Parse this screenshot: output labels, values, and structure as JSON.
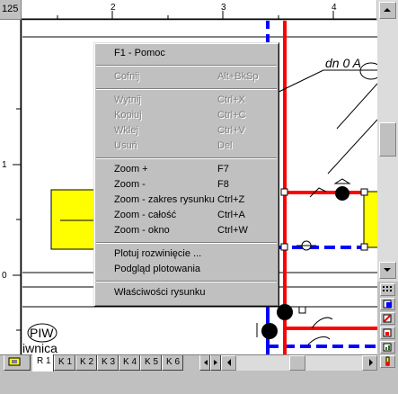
{
  "ruler": {
    "corner_label": "125",
    "top_ticks": [
      "2",
      "3",
      "4"
    ],
    "left_ticks": [
      "1",
      "0"
    ]
  },
  "drawing": {
    "label_dn": "dn 0 A",
    "label_piw": "PIW",
    "label_piwnica": "iwnica",
    "colors": {
      "supply": "#ff0000",
      "return": "#0000ff",
      "device": "#ffff00",
      "fitting": "#000000"
    }
  },
  "context_menu": {
    "groups": [
      [
        {
          "label": "F1 - Pomoc",
          "shortcut": "",
          "enabled": true
        }
      ],
      [
        {
          "label": "Cofnij",
          "shortcut": "Alt+BkSp",
          "enabled": false
        }
      ],
      [
        {
          "label": "Wytnij",
          "shortcut": "Ctrl+X",
          "enabled": false
        },
        {
          "label": "Kopiuj",
          "shortcut": "Ctrl+C",
          "enabled": false
        },
        {
          "label": "Wklej",
          "shortcut": "Ctrl+V",
          "enabled": false
        },
        {
          "label": "Usuń",
          "shortcut": "Del",
          "enabled": false
        }
      ],
      [
        {
          "label": "Zoom +",
          "shortcut": "F7",
          "enabled": true
        },
        {
          "label": "Zoom -",
          "shortcut": "F8",
          "enabled": true
        },
        {
          "label": "Zoom - zakres rysunku",
          "shortcut": "Ctrl+Z",
          "enabled": true
        },
        {
          "label": "Zoom - całość",
          "shortcut": "Ctrl+A",
          "enabled": true
        },
        {
          "label": "Zoom - okno",
          "shortcut": "Ctrl+W",
          "enabled": true
        }
      ],
      [
        {
          "label": "Plotuj rozwinięcie ...",
          "shortcut": "",
          "enabled": true
        },
        {
          "label": "Podgląd plotowania",
          "shortcut": "",
          "enabled": true
        }
      ],
      [
        {
          "label": "Właściwości rysunku",
          "shortcut": "",
          "enabled": true
        }
      ]
    ]
  },
  "sheet_tabs": [
    "R 1",
    "K 1",
    "K 2",
    "K 3",
    "K 4",
    "K 5",
    "K 6"
  ],
  "active_sheet": "R 1",
  "icons": {
    "scroll_up": "arrow-up-icon",
    "scroll_down": "arrow-down-icon",
    "scroll_left": "arrow-left-icon",
    "scroll_right": "arrow-right-icon"
  }
}
